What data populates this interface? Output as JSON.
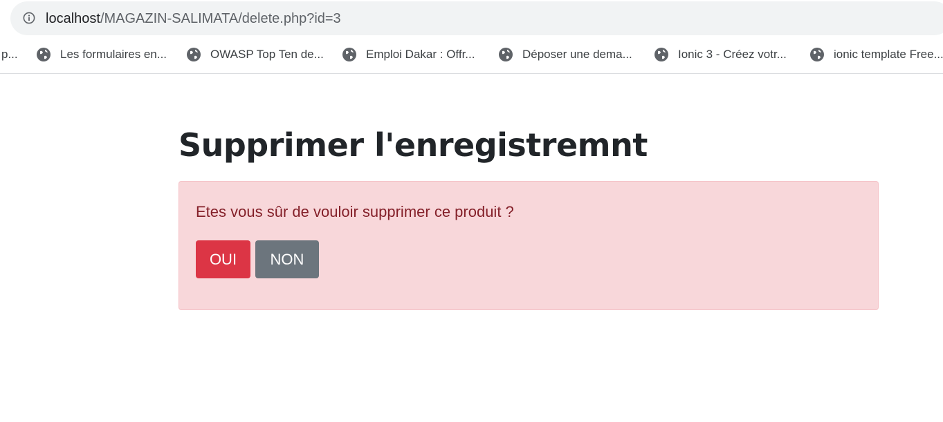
{
  "browser": {
    "url_host": "localhost",
    "url_path": "/MAGAZIN-SALIMATA/delete.php?id=3",
    "bookmarks": [
      {
        "label": "p..."
      },
      {
        "label": "Les formulaires en..."
      },
      {
        "label": "OWASP Top Ten de..."
      },
      {
        "label": "Emploi Dakar : Offr..."
      },
      {
        "label": "Déposer une dema..."
      },
      {
        "label": "Ionic 3 - Créez votr..."
      },
      {
        "label": "ionic template Free..."
      }
    ]
  },
  "main": {
    "title": "Supprimer l'enregistremnt",
    "alert": {
      "message": "Etes vous sûr de vouloir supprimer ce produit ?",
      "yes_label": "OUI",
      "no_label": "NON"
    }
  },
  "colors": {
    "danger": "#dc3545",
    "secondary": "#6c757d",
    "alert_bg": "#f8d7da",
    "alert_text": "#842029"
  }
}
